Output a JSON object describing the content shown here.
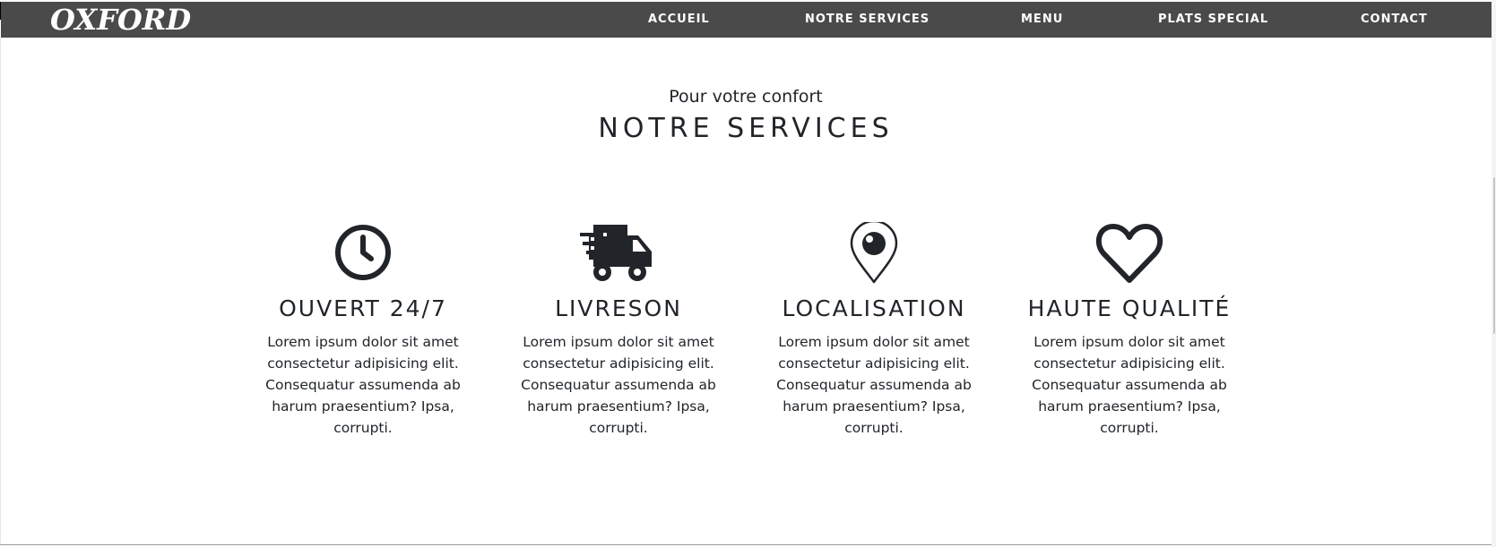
{
  "navbar": {
    "brand": "OXFORD",
    "links": [
      "ACCUEIL",
      "NOTRE SERVICES",
      "MENU",
      "PLATS SPECIAL",
      "CONTACT"
    ]
  },
  "section": {
    "subtitle": "Pour votre confort",
    "title": "NOTRE SERVICES"
  },
  "services": [
    {
      "icon": "clock-icon",
      "title": "OUVERT 24/7",
      "text": "Lorem ipsum dolor sit amet consectetur adipisicing elit. Consequatur assumenda ab harum praesentium? Ipsa, corrupti."
    },
    {
      "icon": "delivery-truck-icon",
      "title": "LIVRESON",
      "text": "Lorem ipsum dolor sit amet consectetur adipisicing elit. Consequatur assumenda ab harum praesentium? Ipsa, corrupti."
    },
    {
      "icon": "location-pin-icon",
      "title": "LOCALISATION",
      "text": "Lorem ipsum dolor sit amet consectetur adipisicing elit. Consequatur assumenda ab harum praesentium? Ipsa, corrupti."
    },
    {
      "icon": "heart-icon",
      "title": "HAUTE QUALITÉ",
      "text": "Lorem ipsum dolor sit amet consectetur adipisicing elit. Consequatur assumenda ab harum praesentium? Ipsa, corrupti."
    }
  ],
  "colors": {
    "navbar_bg": "#4a4a4a",
    "text": "#212529",
    "icon": "#212529"
  }
}
